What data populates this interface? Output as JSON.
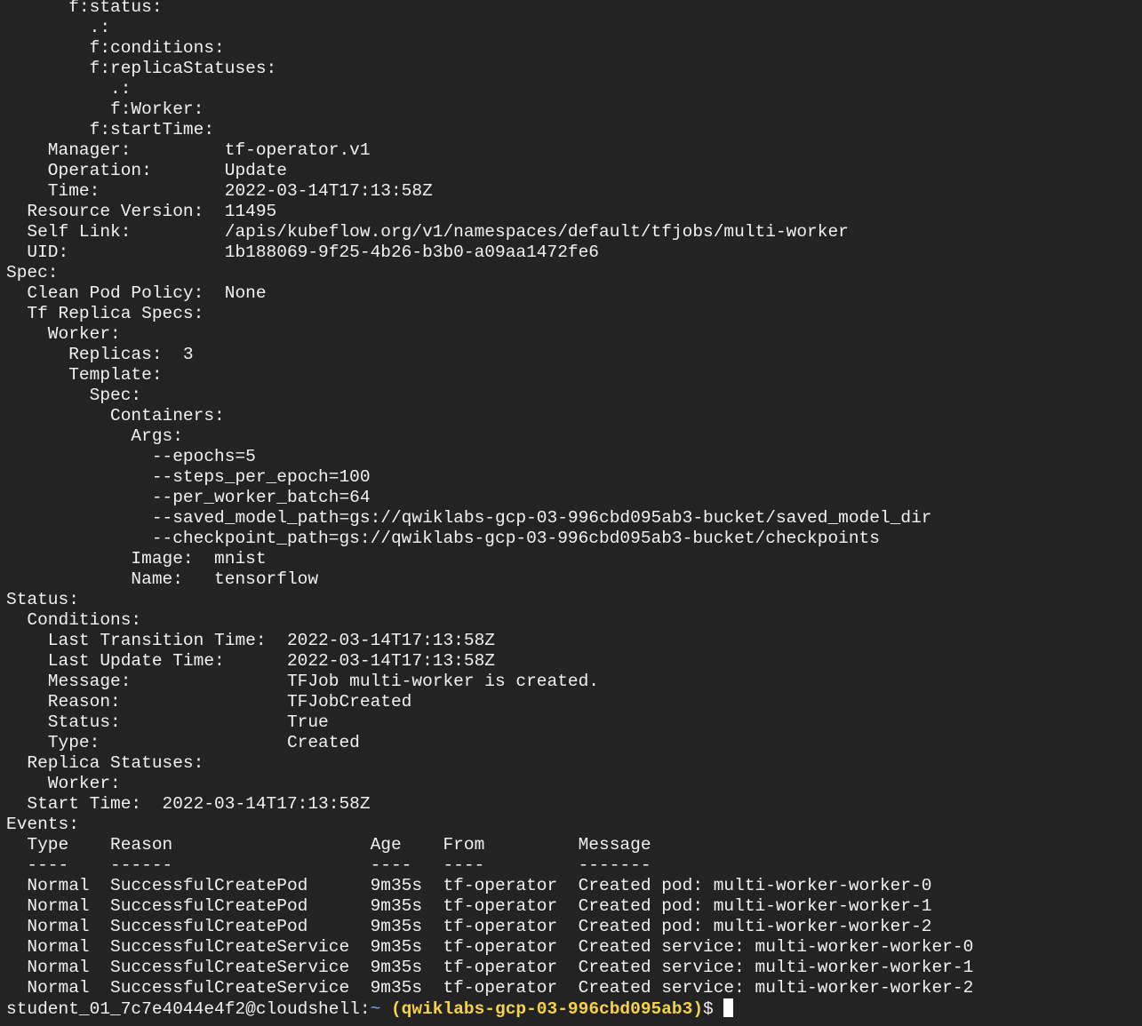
{
  "terminal": {
    "lines": [
      "      f:status:",
      "        .:",
      "        f:conditions:",
      "        f:replicaStatuses:",
      "          .:",
      "          f:Worker:",
      "        f:startTime:",
      "    Manager:         tf-operator.v1",
      "    Operation:       Update",
      "    Time:            2022-03-14T17:13:58Z",
      "  Resource Version:  11495",
      "  Self Link:         /apis/kubeflow.org/v1/namespaces/default/tfjobs/multi-worker",
      "  UID:               1b188069-9f25-4b26-b3b0-a09aa1472fe6",
      "Spec:",
      "  Clean Pod Policy:  None",
      "  Tf Replica Specs:",
      "    Worker:",
      "      Replicas:  3",
      "      Template:",
      "        Spec:",
      "          Containers:",
      "            Args:",
      "              --epochs=5",
      "              --steps_per_epoch=100",
      "              --per_worker_batch=64",
      "              --saved_model_path=gs://qwiklabs-gcp-03-996cbd095ab3-bucket/saved_model_dir",
      "              --checkpoint_path=gs://qwiklabs-gcp-03-996cbd095ab3-bucket/checkpoints",
      "            Image:  mnist",
      "            Name:   tensorflow",
      "Status:",
      "  Conditions:",
      "    Last Transition Time:  2022-03-14T17:13:58Z",
      "    Last Update Time:      2022-03-14T17:13:58Z",
      "    Message:               TFJob multi-worker is created.",
      "    Reason:                TFJobCreated",
      "    Status:                True",
      "    Type:                  Created",
      "  Replica Statuses:",
      "    Worker:",
      "  Start Time:  2022-03-14T17:13:58Z",
      "Events:",
      "  Type    Reason                   Age    From         Message",
      "  ----    ------                   ----   ----         -------",
      "  Normal  SuccessfulCreatePod      9m35s  tf-operator  Created pod: multi-worker-worker-0",
      "  Normal  SuccessfulCreatePod      9m35s  tf-operator  Created pod: multi-worker-worker-1",
      "  Normal  SuccessfulCreatePod      9m35s  tf-operator  Created pod: multi-worker-worker-2",
      "  Normal  SuccessfulCreateService  9m35s  tf-operator  Created service: multi-worker-worker-0",
      "  Normal  SuccessfulCreateService  9m35s  tf-operator  Created service: multi-worker-worker-1",
      "  Normal  SuccessfulCreateService  9m35s  tf-operator  Created service: multi-worker-worker-2"
    ],
    "prompt": {
      "user_host": "student_01_7c7e4044e4f2@cloudshell:",
      "path": "~",
      "project": " (qwiklabs-gcp-03-996cbd095ab3)",
      "symbol": "$ "
    },
    "colors": {
      "background": "#232323",
      "text": "#f2f2f2",
      "path": "#7fa7ff",
      "project": "#f5d24a",
      "cursor": "#ffffff"
    }
  }
}
